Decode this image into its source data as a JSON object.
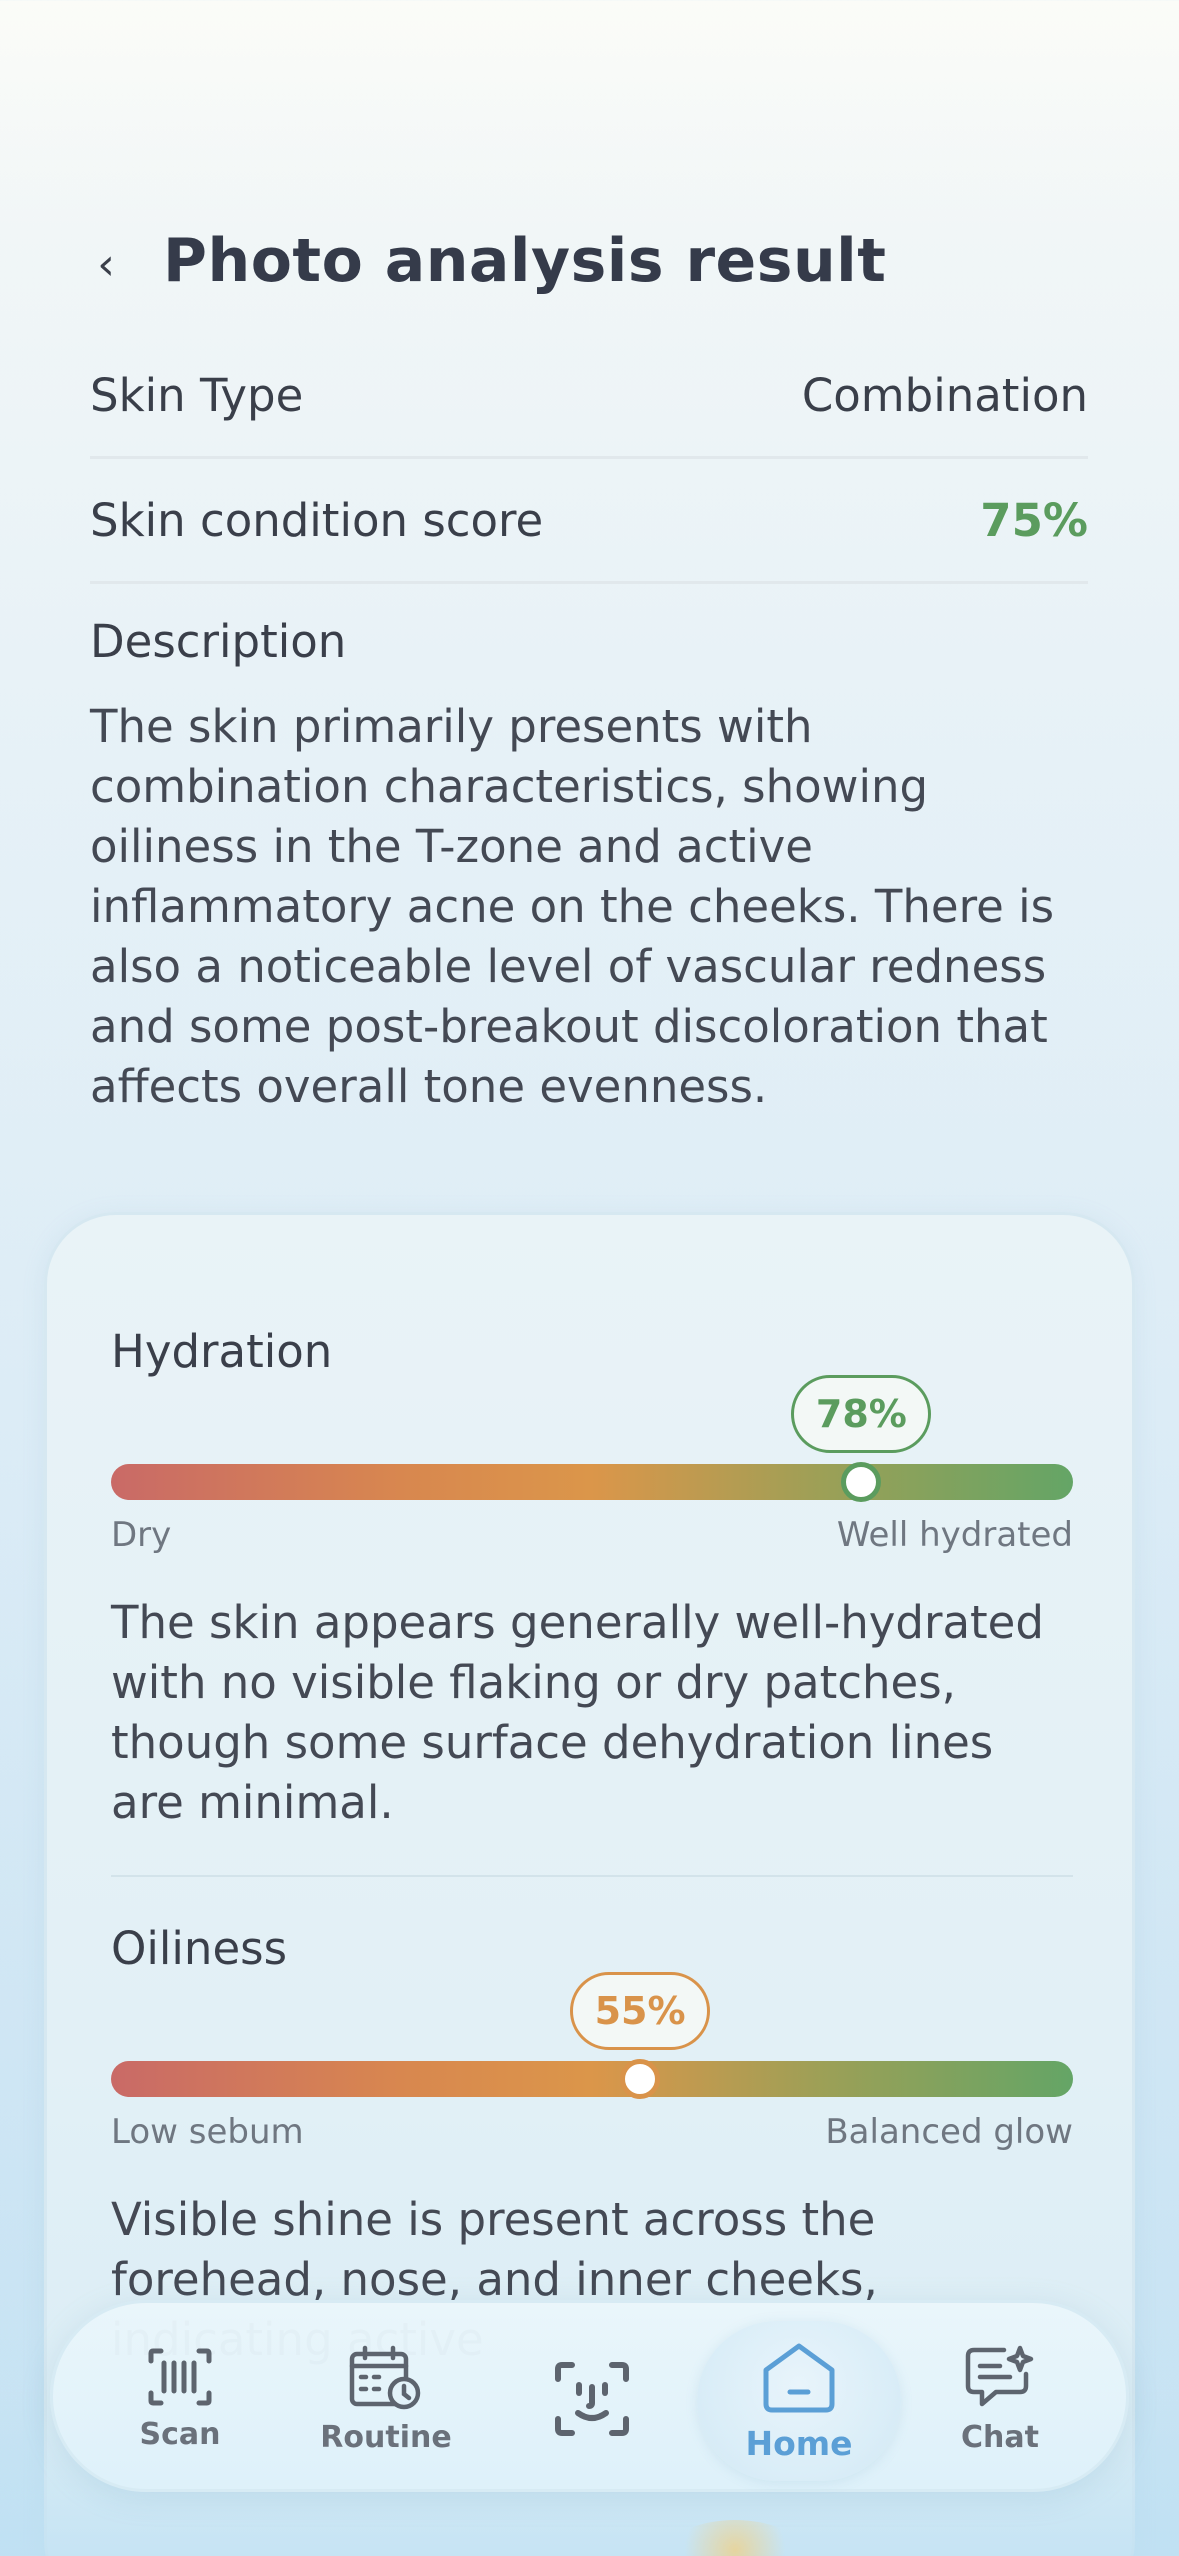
{
  "header": {
    "back_label": "‹",
    "title": "Photo analysis result"
  },
  "summary": {
    "skin_type_label": "Skin Type",
    "skin_type_value": "Combination",
    "score_label": "Skin condition score",
    "score_value": "75%",
    "score_color": "#5b9c5e",
    "description_label": "Description",
    "description_text": "The skin primarily presents with combination characteristics, showing oiliness in the T-zone and active inflammatory acne on the cheeks. There is also a noticeable level of vascular redness and some post-breakout discoloration that affects overall tone evenness."
  },
  "metrics": [
    {
      "title": "Hydration",
      "value": 78,
      "value_label": "78%",
      "accent": "#5b9c5e",
      "low_label": "Dry",
      "high_label": "Well hydrated",
      "description": "The skin appears generally well-hydrated with no visible flaking or dry patches, though some surface dehydration lines are minimal."
    },
    {
      "title": "Oiliness",
      "value": 55,
      "value_label": "55%",
      "accent": "#d9934a",
      "low_label": "Low sebum",
      "high_label": "Balanced glow",
      "description": "Visible shine is present across the forehead, nose, and inner cheeks, indicating active"
    }
  ],
  "tabbar": {
    "active": "Home",
    "items": [
      {
        "label": "Scan",
        "icon": "barcode-scan-icon"
      },
      {
        "label": "Routine",
        "icon": "calendar-clock-icon"
      },
      {
        "label": "",
        "icon": "face-scan-icon"
      },
      {
        "label": "Home",
        "icon": "home-icon"
      },
      {
        "label": "Chat",
        "icon": "chat-sparkle-icon"
      }
    ],
    "active_color": "#5b9fd6",
    "inactive_color": "#5d646e"
  }
}
